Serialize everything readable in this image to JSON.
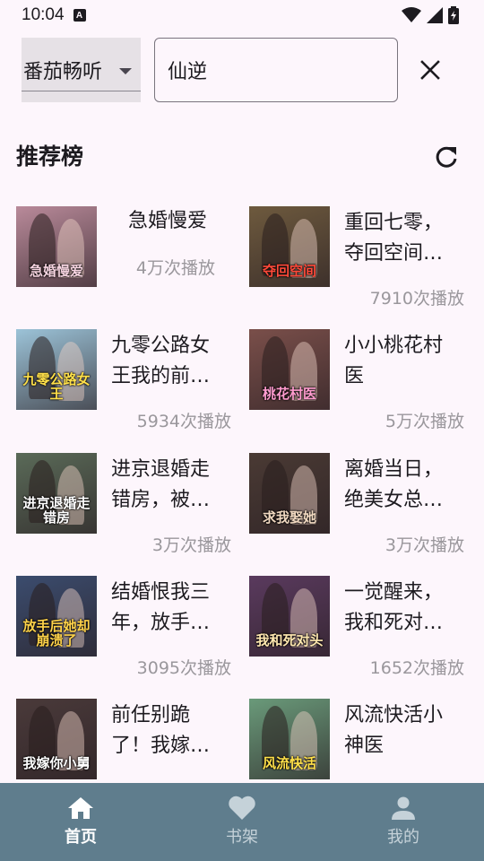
{
  "status_bar": {
    "time": "10:04",
    "indicator": "A"
  },
  "search": {
    "source_label": "番茄畅听",
    "query": "仙逆"
  },
  "section": {
    "title": "推荐榜"
  },
  "books": [
    {
      "title": "急婚慢爱",
      "plays": "4万次播放",
      "cover_text": "急婚慢爱",
      "cover_bg": "#b98a9a",
      "cover_text_color": "#f6d4e0"
    },
    {
      "title": "重回七零，夺回空间…",
      "plays": "7910次播放",
      "cover_text": "夺回空间",
      "cover_bg": "#6e5a3e",
      "cover_text_color": "#ff4a3a"
    },
    {
      "title": "九零公路女王我的前…",
      "plays": "5934次播放",
      "cover_text": "九零公路女王",
      "cover_bg": "#9cc3d8",
      "cover_text_color": "#ffe04a"
    },
    {
      "title": "小小桃花村医",
      "plays": "5万次播放",
      "cover_text": "桃花村医",
      "cover_bg": "#7a4f4a",
      "cover_text_color": "#ff9ccf"
    },
    {
      "title": "进京退婚走错房，被…",
      "plays": "3万次播放",
      "cover_text": "进京退婚走错房",
      "cover_bg": "#5a6a58",
      "cover_text_color": "#ffffff"
    },
    {
      "title": "离婚当日，绝美女总…",
      "plays": "3万次播放",
      "cover_text": "求我娶她",
      "cover_bg": "#4a3a34",
      "cover_text_color": "#f0d8c0"
    },
    {
      "title": "结婚恨我三年，放手…",
      "plays": "3095次播放",
      "cover_text": "放手后她却崩溃了",
      "cover_bg": "#3b4c6e",
      "cover_text_color": "#ffd34a"
    },
    {
      "title": "一觉醒来，我和死对…",
      "plays": "1652次播放",
      "cover_text": "我和死对头",
      "cover_bg": "#5a3a5e",
      "cover_text_color": "#ffe8b0"
    },
    {
      "title": "前任别跪了！我嫁…",
      "plays": "",
      "cover_text": "我嫁你小舅",
      "cover_bg": "#4a3a3a",
      "cover_text_color": "#ffffff"
    },
    {
      "title": "风流快活小神医",
      "plays": "",
      "cover_text": "风流快活",
      "cover_bg": "#6a9a7a",
      "cover_text_color": "#ffe04a"
    }
  ],
  "nav": {
    "home": "首页",
    "shelf": "书架",
    "mine": "我的"
  },
  "colors": {
    "nav_bg": "#5f7d8d",
    "page_bg": "#fdf6fc",
    "play_count": "#9a979c"
  }
}
